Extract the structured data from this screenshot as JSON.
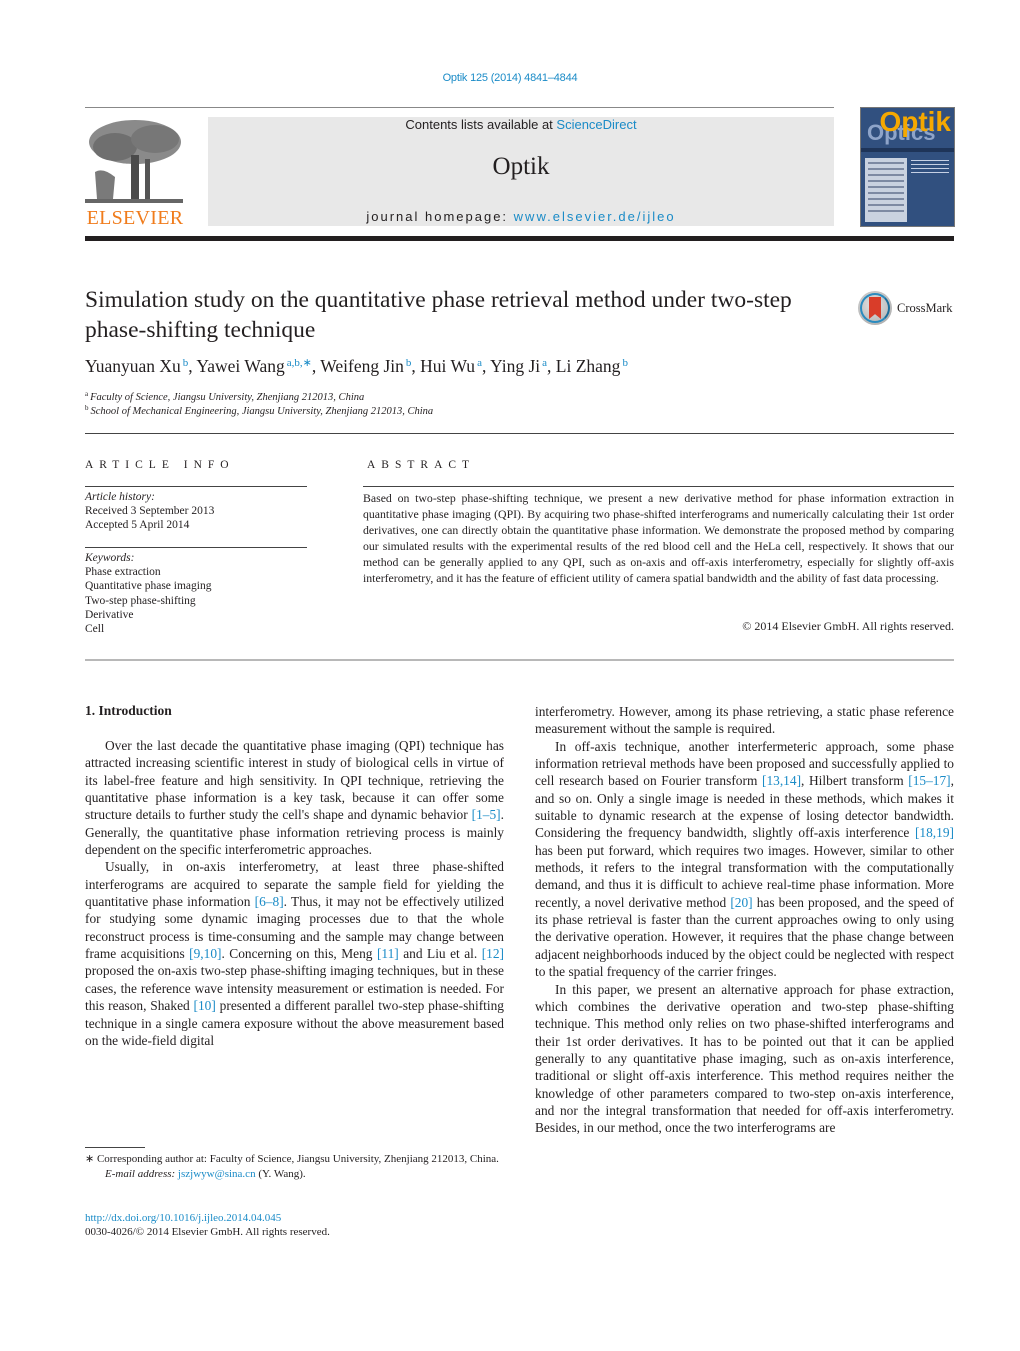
{
  "header": {
    "citation": "Optik 125 (2014) 4841–4844",
    "contents_prefix": "Contents lists available at ",
    "contents_link": "ScienceDirect",
    "journal_name": "Optik",
    "homepage_prefix": "journal homepage: ",
    "homepage_link": "www.elsevier.de/ijleo",
    "publisher_logo_text": "ELSEVIER",
    "cover": {
      "title_top": "Optik",
      "title_bottom": "Optics"
    },
    "crossmark_label": "CrossMark"
  },
  "article": {
    "title": "Simulation study on the quantitative phase retrieval method under two-step phase-shifting technique",
    "authors": [
      {
        "name": "Yuanyuan Xu",
        "sup": "b",
        "sep": ", "
      },
      {
        "name": "Yawei Wang",
        "sup": "a,b,∗",
        "sep": ", "
      },
      {
        "name": "Weifeng Jin",
        "sup": "b",
        "sep": ", "
      },
      {
        "name": "Hui Wu",
        "sup": "a",
        "sep": ", "
      },
      {
        "name": "Ying Ji",
        "sup": "a",
        "sep": ", "
      },
      {
        "name": "Li Zhang",
        "sup": "b",
        "sep": ""
      }
    ],
    "affiliations": [
      {
        "mark": "a",
        "text": "Faculty of Science, Jiangsu University, Zhenjiang 212013, China"
      },
      {
        "mark": "b",
        "text": "School of Mechanical Engineering, Jiangsu University, Zhenjiang 212013, China"
      }
    ]
  },
  "article_info": {
    "heading": "ARTICLE INFO",
    "history_label": "Article history:",
    "received": "Received 3 September 2013",
    "accepted": "Accepted 5 April 2014",
    "keywords_label": "Keywords:",
    "keywords": [
      "Phase extraction",
      "Quantitative phase imaging",
      "Two-step phase-shifting",
      "Derivative",
      "Cell"
    ]
  },
  "abstract": {
    "heading": "ABSTRACT",
    "text": "Based on two-step phase-shifting technique, we present a new derivative method for phase information extraction in quantitative phase imaging (QPI). By acquiring two phase-shifted interferograms and numerically calculating their 1st order derivatives, one can directly obtain the quantitative phase information. We demonstrate the proposed method by comparing our simulated results with the experimental results of the red blood cell and the HeLa cell, respectively. It shows that our method can be generally applied to any QPI, such as on-axis and off-axis interferometry, especially for slightly off-axis interferometry, and it has the feature of efficient utility of camera spatial bandwidth and the ability of fast data processing.",
    "copyright": "© 2014 Elsevier GmbH. All rights reserved."
  },
  "body": {
    "section1_title": "1.  Introduction",
    "left_paragraphs": [
      [
        {
          "t": "Over the last decade the quantitative phase imaging (QPI) technique has attracted increasing scientific interest in study of biological cells in virtue of its label-free feature and high sensitivity. In QPI technique, retrieving the quantitative phase information is a key task, because it can offer some structure details to further study the cell's shape and dynamic behavior "
        },
        {
          "ref": "[1–5]"
        },
        {
          "t": ". Generally, the quantitative phase information retrieving process is mainly dependent on the specific interferometric approaches."
        }
      ],
      [
        {
          "t": "Usually, in on-axis interferometry, at least three phase-shifted interferograms are acquired to separate the sample field for yielding the quantitative phase information "
        },
        {
          "ref": "[6–8]"
        },
        {
          "t": ". Thus, it may not be effectively utilized for studying some dynamic imaging processes due to that the whole reconstruct process is time-consuming and the sample may change between frame acquisitions "
        },
        {
          "ref": "[9,10]"
        },
        {
          "t": ". Concerning on this, Meng "
        },
        {
          "ref": "[11]"
        },
        {
          "t": " and Liu et al. "
        },
        {
          "ref": "[12]"
        },
        {
          "t": " proposed the on-axis two-step phase-shifting imaging techniques, but in these cases, the reference wave intensity measurement or estimation is needed. For this reason, Shaked "
        },
        {
          "ref": "[10]"
        },
        {
          "t": " presented a different parallel two-step phase-shifting technique in a single camera exposure without the above measurement based on the wide-field digital"
        }
      ]
    ],
    "right_paragraphs": [
      [
        {
          "t": "interferometry. However, among its phase retrieving, a static phase reference measurement without the sample is required."
        }
      ],
      [
        {
          "t": "In off-axis technique, another interfermeteric approach, some phase information retrieval methods have been proposed and successfully applied to cell research based on Fourier transform "
        },
        {
          "ref": "[13,14]"
        },
        {
          "t": ", Hilbert transform "
        },
        {
          "ref": "[15–17]"
        },
        {
          "t": ", and so on. Only a single image is needed in these methods, which makes it suitable to dynamic research at the expense of losing detector bandwidth. Considering the frequency bandwidth, slightly off-axis interference "
        },
        {
          "ref": "[18,19]"
        },
        {
          "t": " has been put forward, which requires two images. However, similar to other methods, it refers to the integral transformation with the computationally demand, and thus it is difficult to achieve real-time phase information. More recently, a novel derivative method "
        },
        {
          "ref": "[20]"
        },
        {
          "t": " has been proposed, and the speed of its phase retrieval is faster than the current approaches owing to only using the derivative operation. However, it requires that the phase change between adjacent neighborhoods induced by the object could be neglected with respect to the spatial frequency of the carrier fringes."
        }
      ],
      [
        {
          "t": "In this paper, we present an alternative approach for phase extraction, which combines the derivative operation and two-step phase-shifting technique. This method only relies on two phase-shifted interferograms and their 1st order derivatives. It has to be pointed out that it can be applied generally to any quantitative phase imaging, such as on-axis interference, traditional or slight off-axis interference. This method requires neither the knowledge of other parameters compared to two-step on-axis interference, and nor the integral transformation that needed for off-axis interferometry. Besides, in our method, once the two interferograms are"
        }
      ]
    ]
  },
  "footnote": {
    "corresponding": "∗  Corresponding author at: Faculty of Science, Jiangsu University, Zhenjiang 212013, China.",
    "email_label": "E-mail address:",
    "email": "jszjwyw@sina.cn",
    "email_suffix": " (Y. Wang).",
    "doi": "http://dx.doi.org/10.1016/j.ijleo.2014.04.045",
    "issn": "0030-4026/© 2014 Elsevier GmbH. All rights reserved."
  }
}
